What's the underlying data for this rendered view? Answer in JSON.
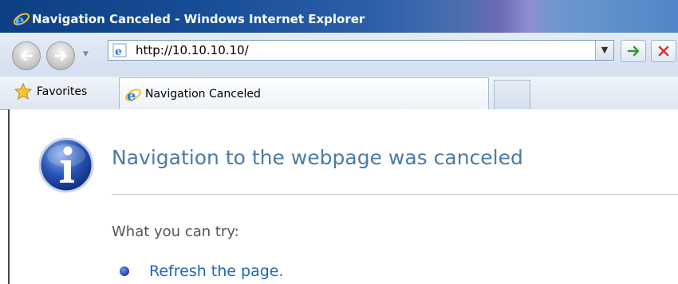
{
  "window": {
    "title": "Navigation Canceled - Windows Internet Explorer",
    "app_icon": "ie-logo-icon"
  },
  "toolbar": {
    "back_icon": "back-arrow-icon",
    "forward_icon": "forward-arrow-icon",
    "history_dropdown_icon": "chevron-down-icon",
    "address": {
      "url": "http://10.10.10.10/",
      "page_icon": "ie-page-icon",
      "dropdown_icon": "chevron-down-icon"
    },
    "go_icon": "green-arrow-icon",
    "stop_icon": "red-x-icon"
  },
  "favorites_bar": {
    "favorites_label": "Favorites",
    "favorites_icon": "star-icon",
    "tabs": [
      {
        "label": "Navigation Canceled",
        "icon": "ie-page-icon",
        "active": true
      }
    ],
    "new_tab_icon": "new-tab-icon"
  },
  "page": {
    "icon": "info-icon",
    "heading": "Navigation to the webpage was canceled",
    "try_label": "What you can try:",
    "suggestions": [
      {
        "text": "Refresh the page."
      }
    ]
  },
  "colors": {
    "heading": "#4b7ba6",
    "link": "#1c68b8",
    "titlebar_start": "#0d3f82",
    "titlebar_end": "#4f86c7"
  }
}
